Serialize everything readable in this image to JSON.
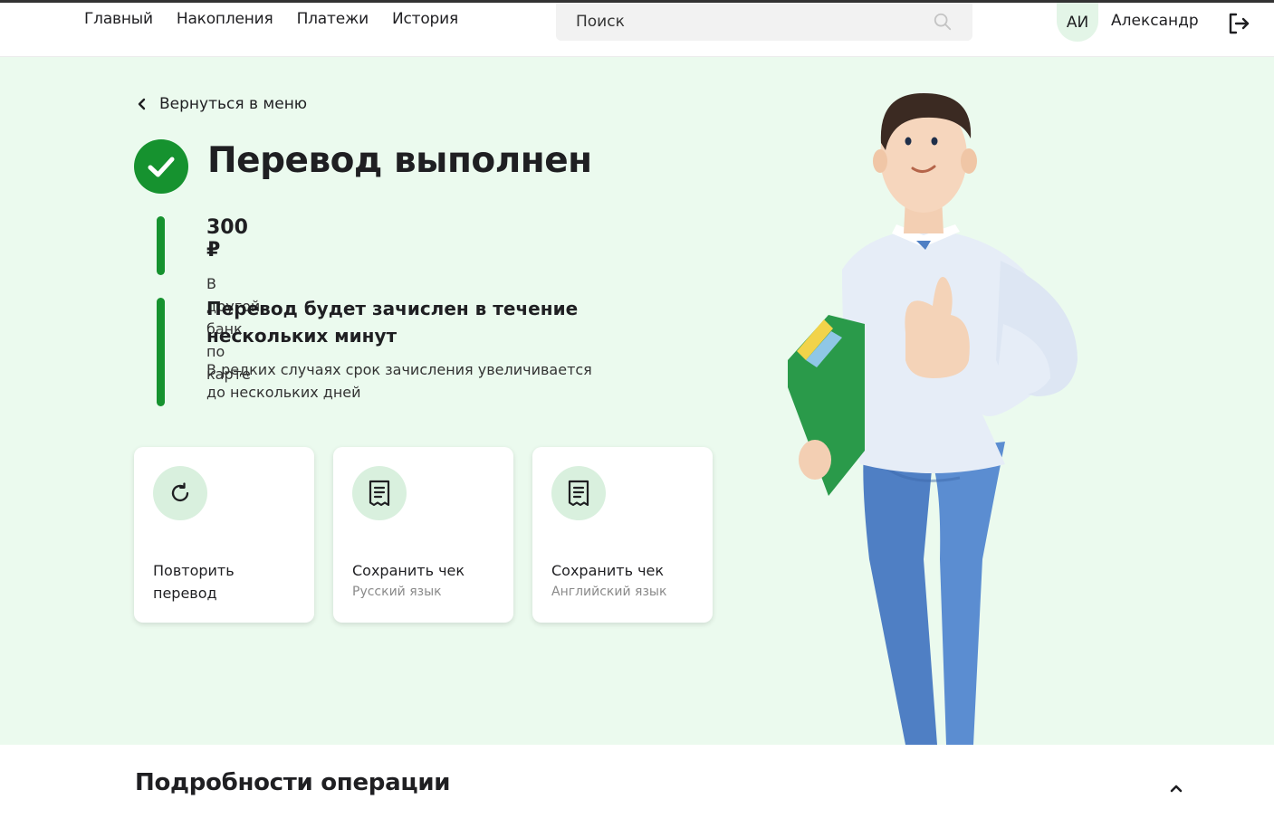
{
  "nav": {
    "items": [
      {
        "label": "Главный"
      },
      {
        "label": "Накопления"
      },
      {
        "label": "Платежи"
      },
      {
        "label": "История"
      }
    ]
  },
  "search": {
    "placeholder": "Поиск",
    "icon": "search-icon"
  },
  "user": {
    "initials": "АИ",
    "name": "Александр",
    "logout_icon": "logout-icon"
  },
  "hero": {
    "back_label": "Вернуться в меню",
    "title": "Перевод выполнен",
    "amount": "300 ₽",
    "amount_desc": "В другой банк по карте",
    "note_title_line1": "Перевод будет зачислен в течение",
    "note_title_line2": "нескольких минут",
    "note_desc_line1": "В редких случаях срок зачисления увеличивается",
    "note_desc_line2": "до нескольких дней"
  },
  "cards": [
    {
      "line1": "Повторить",
      "line2": "перевод",
      "sub": "",
      "icon": "refresh-icon"
    },
    {
      "line1": "Сохранить чек",
      "line2": "",
      "sub": "Русский язык",
      "icon": "receipt-icon"
    },
    {
      "line1": "Сохранить чек",
      "line2": "",
      "sub": "Английский язык",
      "icon": "receipt-icon"
    }
  ],
  "details": {
    "title": "Подробности операции"
  },
  "colors": {
    "accent": "#16922f",
    "hero_bg": "#ebfaee",
    "icon_bg": "#d9f0de"
  }
}
